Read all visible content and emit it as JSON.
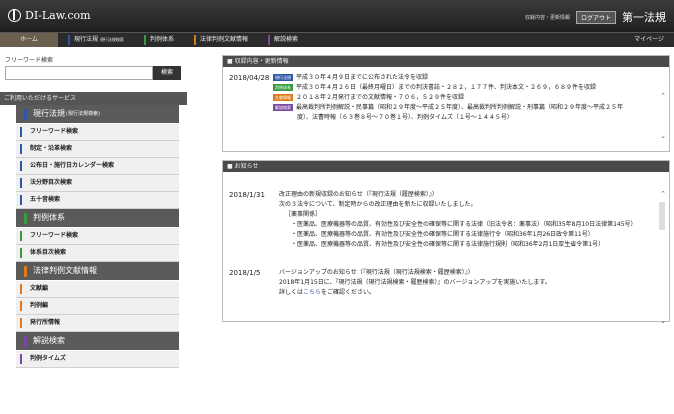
{
  "header": {
    "logo": "DI-Law.com",
    "small_links": "収録内容・更新情報",
    "logout": "ログアウト",
    "company": "第一法規"
  },
  "nav": {
    "home": "ホーム",
    "genko": "現行法規",
    "genko_sub": "現行法規検索",
    "taikei": "判例体系",
    "bunken": "法律判例文献情報",
    "kaisetsu": "解説検索",
    "mypage": "マイページ"
  },
  "sidebar": {
    "freeword_label": "フリーワード検索",
    "search_button": "検索",
    "services_head": "ご利用いただけるサービス",
    "groups": [
      {
        "title": "現行法規",
        "sub": "(現行法規検索)",
        "items": [
          "フリーワード検索",
          "制定・沿革検索",
          "公布日・施行日カレンダー検索",
          "法分野目次検索",
          "五十音検索"
        ]
      },
      {
        "title": "判例体系",
        "sub": "",
        "items": [
          "フリーワード検索",
          "体系目次検索"
        ]
      },
      {
        "title": "法律判例文献情報",
        "sub": "",
        "items": [
          "文献編",
          "判例編",
          "発行所情報"
        ]
      },
      {
        "title": "解説検索",
        "sub": "",
        "items": [
          "判例タイムズ"
        ]
      }
    ]
  },
  "updates": {
    "head": "■ 収録内容・更新情報",
    "date": "2018/04/28",
    "rows": [
      {
        "tag": "現行法規",
        "text": "平成３０年４月９日までに公布された法令を収録"
      },
      {
        "tag": "判例体系",
        "text": "平成３０年４月２６日（最終月曜日）までの判決書誌・２８２，１７７件、判決本文・２６９，６８９件を収録"
      },
      {
        "tag": "文献情報",
        "text": "２０１８年２月発行までの文献情報・７０６，５２９件を収録"
      },
      {
        "tag": "解説検索",
        "text": "最高裁判所判例解説・民事篇（昭和２９年度〜平成２５年度）、最高裁判所判例解説・刑事篇（昭和２９年度〜平成２５年"
      },
      {
        "tag": "",
        "text": "度）、法曹時報（６３巻８号〜７０巻１号）、判例タイムズ（１号〜１４４５号）"
      }
    ],
    "tag_colors": [
      "#2f56a8",
      "#3a9a3e",
      "#e07a1a",
      "#7b4aa0"
    ]
  },
  "news": {
    "head": "■ お知らせ",
    "items": [
      {
        "date": "2018/1/31",
        "title": "改正理由の新規収録のお知らせ（『現行法規（履歴検索）』）",
        "lines": [
          "次の３法令について、制定時からの改正理由を新たに収録いたしました。",
          "［薬事関係］"
        ],
        "sub": [
          "・医薬品、医療機器等の品質、有効性及び安全性の確保等に関する法律（旧法令名：薬事法）（昭和35年8月10日法律第145号）",
          "・医薬品、医療機器等の品質、有効性及び安全性の確保等に関する法律施行令（昭和36年1月26日政令第11号）",
          "・医薬品、医療機器等の品質、有効性及び安全性の確保等に関する法律施行規則（昭和36年2月1日厚生省令第1号）"
        ]
      },
      {
        "date": "2018/1/5",
        "title": "バージョンアップのお知らせ（『現行法規（現行法規検索・履歴検索）』）",
        "lines": [
          "2018年1月15日に、『現行法規（現行法規検索・履歴検索）』のバージョンアップを実施いたします。"
        ],
        "detail_pre": "詳しくは",
        "detail_link": "こちら",
        "detail_post": "をご確認ください。"
      }
    ]
  },
  "colors": {
    "genko": "#2f56a8",
    "taikei": "#3a9a3e",
    "bunken": "#e07a1a",
    "kaisetsu": "#7b4aa0"
  }
}
